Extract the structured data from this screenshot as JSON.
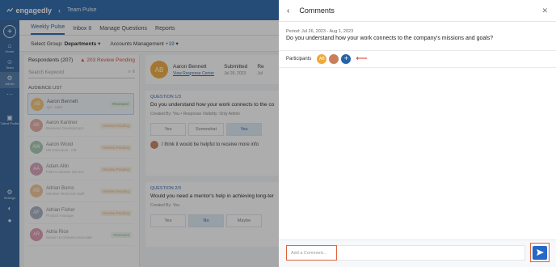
{
  "app": {
    "brand": "engagedly",
    "breadcrumb": "Team Pulse"
  },
  "rail": {
    "items": [
      {
        "icon": "home-icon",
        "label": "Home"
      },
      {
        "icon": "team-icon",
        "label": "Team"
      },
      {
        "icon": "admin-icon",
        "label": "Admin"
      },
      {
        "icon": "more-icon",
        "label": "..."
      },
      {
        "icon": "profile-icon",
        "label": "Talent Profile"
      },
      {
        "icon": "settings-icon",
        "label": "Settings"
      }
    ]
  },
  "tabs": [
    "Weekly Pulse",
    "Inbox",
    "Manage Questions",
    "Reports"
  ],
  "inbox_count": "8",
  "filters": {
    "group_label": "Select Group:",
    "group_value": "Departments",
    "dept": "Accounts Management",
    "dept_count": "+19"
  },
  "respondents": {
    "title": "Respondents (207)",
    "pending": "203 Review Pending",
    "search_placeholder": "Search Keyword",
    "audience_label": "AUDIENCE LIST",
    "people": [
      {
        "initials": "AB",
        "color": "#f0a938",
        "name": "Aaron Bennett",
        "role": "QA - Intel",
        "status": "Reviewed"
      },
      {
        "initials": "AK",
        "color": "#d06a5a",
        "name": "Aaron Kantner",
        "role": "Business Development",
        "status": "Review Pending"
      },
      {
        "initials": "AW",
        "color": "#5c9b6e",
        "name": "Aaron Wood",
        "role": "HR Executive - HR",
        "status": "Review Pending"
      },
      {
        "initials": "AA",
        "color": "#b5527d",
        "name": "Adam Allin",
        "role": "Field Customer Service",
        "status": "Review Pending"
      },
      {
        "initials": "AB",
        "color": "#e5953d",
        "name": "Adrian Burns",
        "role": "Member Technical Staff",
        "status": "Review Pending"
      },
      {
        "initials": "AF",
        "color": "#5b6b8a",
        "name": "Adrian Fisher",
        "role": "Product manager",
        "status": "Review Pending"
      },
      {
        "initials": "AR",
        "color": "#c2416a",
        "name": "Adria Rice",
        "role": "Senior recruitment associate",
        "status": "Reviewed"
      }
    ]
  },
  "detail": {
    "initials": "AB",
    "name": "Aaron Bennett",
    "link": "View Response Center",
    "submitted_label": "Submitted",
    "submitted_date": "Jul 26, 2023",
    "col3_label": "Re",
    "col3_value": "Jul",
    "q1": {
      "num": "QUESTION 1/3",
      "text": "Do you understand how your work connects to the company's missi",
      "meta": "Created By: You  •  Response Visibility: Only Admin",
      "options": [
        "Yes",
        "Somewhat",
        "Yes"
      ],
      "answer": "I think it would be helpful to receive more info"
    },
    "q2": {
      "num": "QUESTION 2/3",
      "text": "Would you need a mentor's help in achieving long-ter",
      "meta": "Created By: You",
      "options": [
        "Yes",
        "No",
        "Maybe"
      ]
    }
  },
  "comments": {
    "title": "Comments",
    "period": "Period: Jul 26, 2023 - Aug 1, 2023",
    "question": "Do you understand how your work connects to the company's missions and goals?",
    "participants_label": "Participants",
    "participants": [
      {
        "initials": "AB",
        "color": "#f0a938"
      },
      {
        "initials": "",
        "color": "#c97e5d"
      }
    ],
    "comment_placeholder": "Add a Comment..."
  }
}
